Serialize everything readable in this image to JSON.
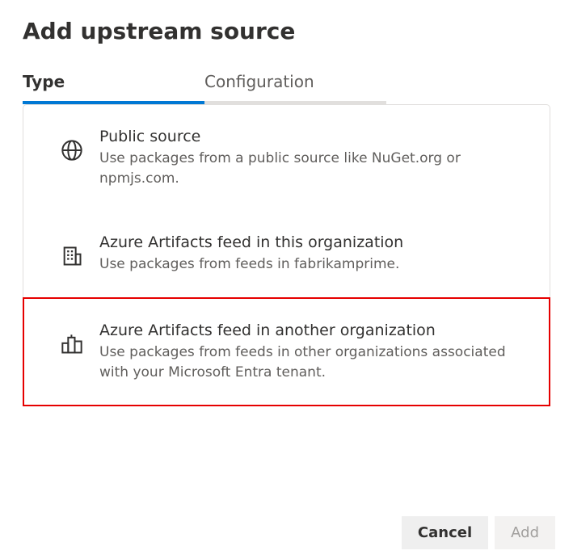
{
  "header": {
    "title": "Add upstream source"
  },
  "tabs": {
    "type": "Type",
    "config": "Configuration"
  },
  "options": {
    "public": {
      "title": "Public source",
      "desc": "Use packages from a public source like NuGet.org or npmjs.com."
    },
    "thisOrg": {
      "title": "Azure Artifacts feed in this organization",
      "desc": "Use packages from feeds in fabrikamprime."
    },
    "otherOrg": {
      "title": "Azure Artifacts feed in another organization",
      "desc": "Use packages from feeds in other organizations associated with your Microsoft Entra tenant."
    }
  },
  "footer": {
    "cancel": "Cancel",
    "add": "Add"
  }
}
